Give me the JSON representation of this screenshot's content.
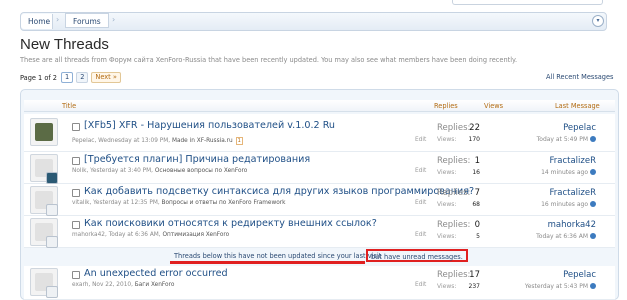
{
  "breadcrumb": {
    "home": "Home",
    "forums": "Forums"
  },
  "page": {
    "title": "New Threads",
    "description": "These are all threads from Форум сайта XenForo-Russia that have been recently updated. You may also see what members have been doing recently."
  },
  "pagination": {
    "label": "Page 1 of 2",
    "pages": [
      "1",
      "2"
    ],
    "next": "Next »",
    "all_recent": "All Recent Messages"
  },
  "columns": {
    "title": "Title",
    "replies": "Replies",
    "views": "Views",
    "last_message": "Last Message"
  },
  "threads": [
    {
      "title": "[XFb5] XFR - Нарушения пользователей v.1.0.2 Ru",
      "author": "Pepelac",
      "date": "Wednesday at 13:09 PM",
      "forum": "Made in XF-Russia.ru",
      "tag": "1",
      "edit": "Edit",
      "replies_label": "Replies:",
      "replies": "22",
      "views_label": "Views:",
      "views": "170",
      "last_user": "Pepelac",
      "last_time": "Today at 5:49 PM"
    },
    {
      "title": "[Требуется плагин] Причина редатирования",
      "author": "Nolik",
      "date": "Yesterday at 3:40 PM",
      "forum": "Основные вопросы по XenForo",
      "edit": "Edit",
      "replies_label": "Replies:",
      "replies": "1",
      "views_label": "Views:",
      "views": "16",
      "last_user": "FractalizeR",
      "last_time": "14 minutes ago"
    },
    {
      "title": "Как добавить подсветку синтаксиса для других языков программирования?",
      "author": "vitalik",
      "date": "Yesterday at 12:35 PM",
      "forum": "Вопросы и ответы по XenForo Framework",
      "edit": "Edit",
      "replies_label": "Replies:",
      "replies": "7",
      "views_label": "Views:",
      "views": "68",
      "last_user": "FractalizeR",
      "last_time": "16 minutes ago"
    },
    {
      "title": "Как поисковики относятся к редиректу внешних ссылок?",
      "author": "mahorka42",
      "date": "Today at 6:36 AM",
      "forum": "Оптимизация XenForo",
      "edit": "Edit",
      "replies_label": "Replies:",
      "replies": "0",
      "views_label": "Views:",
      "views": "5",
      "last_user": "mahorka42",
      "last_time": "Today at 6:36 AM"
    },
    {
      "title": "An unexpected error occurred",
      "author": "exarh",
      "date": "Nov 22, 2010",
      "forum": "Баги XenForo",
      "edit": "Edit",
      "replies_label": "Replies:",
      "replies": "17",
      "views_label": "Views:",
      "views": "237",
      "last_user": "Pepelac",
      "last_time": "Yesterday at 5:43 PM"
    }
  ],
  "separator": {
    "text": "Threads below this have not been updated since your last visit",
    "highlight": "but have unread messages."
  },
  "colors": {
    "link": "#1f4f86",
    "accent_orange": "#b26b12",
    "highlight_red": "#e02020"
  }
}
